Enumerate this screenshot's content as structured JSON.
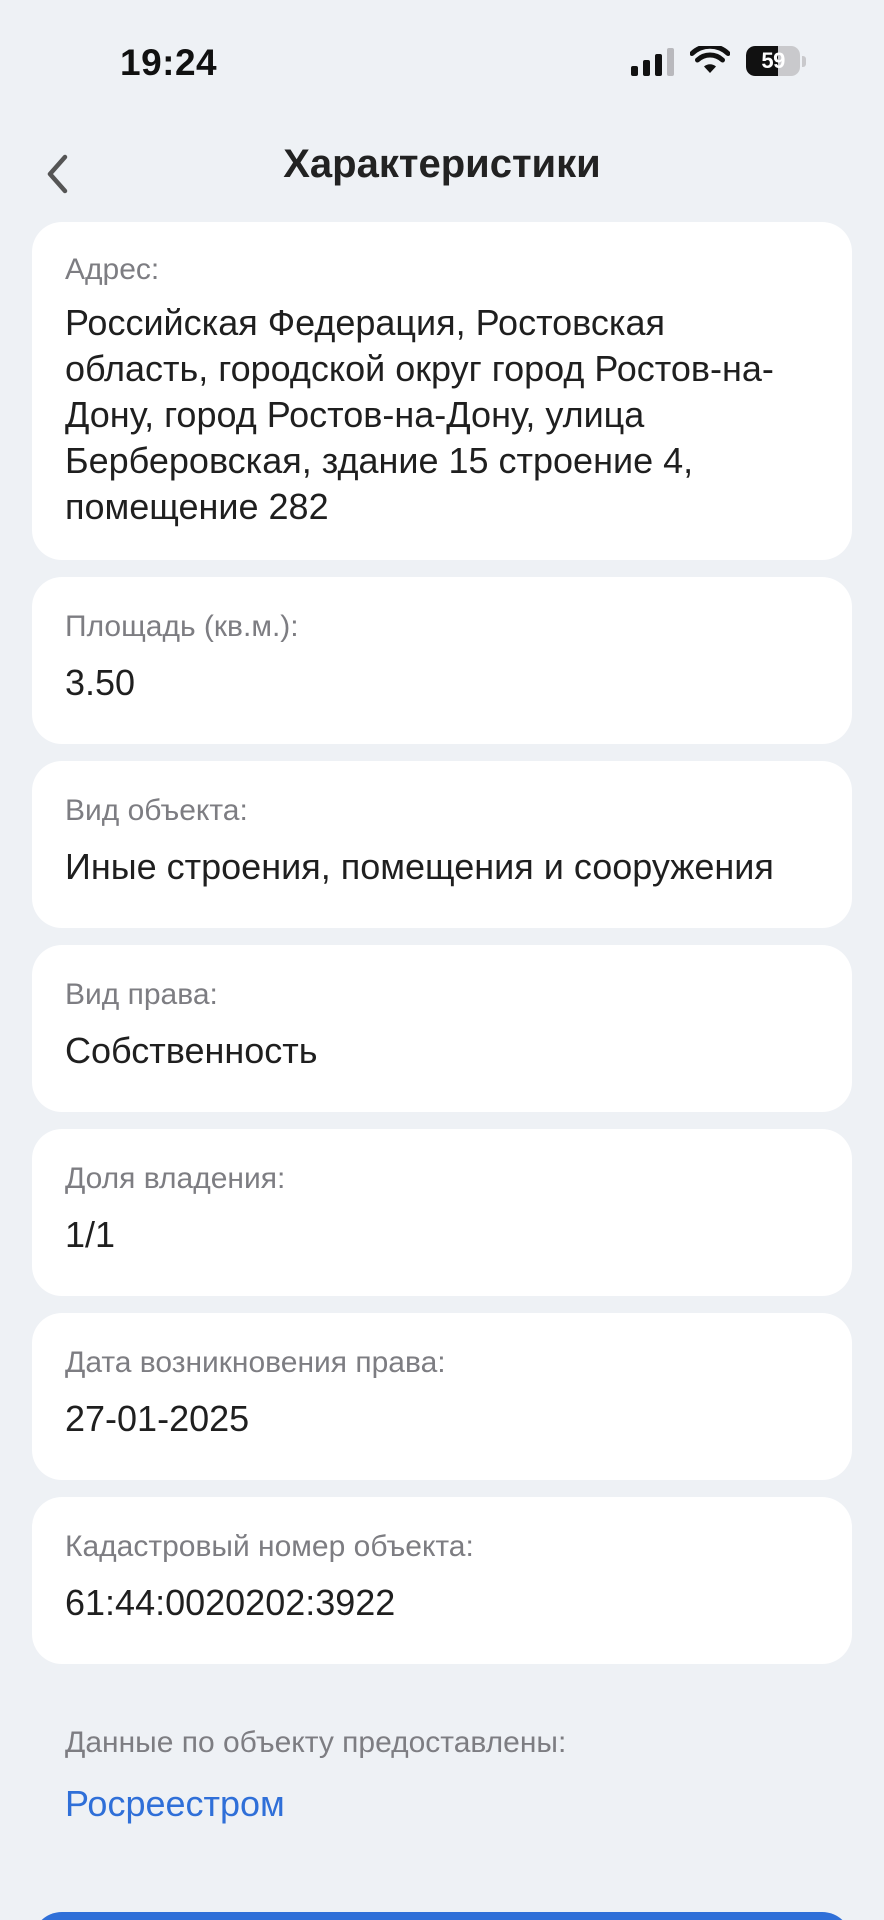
{
  "status_bar": {
    "time": "19:24",
    "battery_level": "59",
    "signal_icon": "cellular-signal-icon",
    "wifi_icon": "wifi-icon",
    "battery_icon": "battery-icon"
  },
  "header": {
    "title": "Характеристики",
    "back_icon": "chevron-left-icon"
  },
  "fields": {
    "address": {
      "label": "Адрес:",
      "value": "Российская Федерация, Ростовская область, городской округ город Ростов-на-Дону, город Ростов-на-Дону, улица Берберовская, здание 15 строение 4, помещение 282"
    },
    "area": {
      "label": "Площадь (кв.м.):",
      "value": "3.50"
    },
    "object_type": {
      "label": "Вид объекта:",
      "value": "Иные строения, помещения и сооружения"
    },
    "right_type": {
      "label": "Вид права:",
      "value": "Собственность"
    },
    "ownership_share": {
      "label": "Доля владения:",
      "value": "1/1"
    },
    "right_date": {
      "label": "Дата возникновения права:",
      "value": "27-01-2025"
    },
    "cadastral_number": {
      "label": "Кадастровый номер объекта:",
      "value": "61:44:0020202:3922"
    }
  },
  "source": {
    "label": "Данные по объекту предоставлены:",
    "link": "Росреестром"
  },
  "colors": {
    "background": "#eef1f5",
    "card": "#ffffff",
    "label": "#7d7d82",
    "link": "#2f6fd8"
  }
}
